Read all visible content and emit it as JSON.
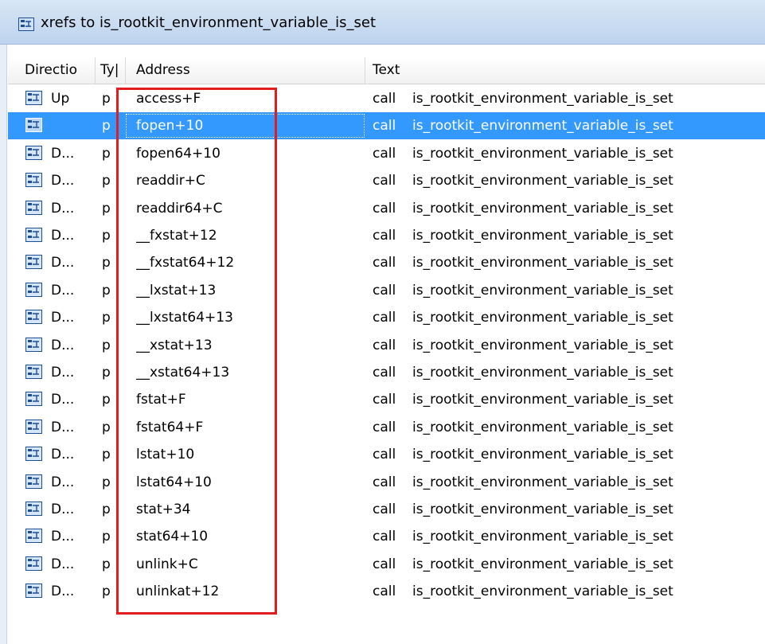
{
  "window": {
    "title": "xrefs to is_rootkit_environment_variable_is_set",
    "icon": "xref-window-icon"
  },
  "columns": {
    "direction": "Directio",
    "type": "Ty|",
    "address": "Address",
    "text": "Text"
  },
  "selected_row_index": 1,
  "highlight_color": "#e31d1d",
  "selection_color": "#3399ff",
  "rows": [
    {
      "direction": "Up",
      "type": "p",
      "address": "access+F",
      "instr": "call",
      "target": "is_rootkit_environment_variable_is_set"
    },
    {
      "direction": "",
      "type": "p",
      "address": "fopen+10",
      "instr": "call",
      "target": "is_rootkit_environment_variable_is_set"
    },
    {
      "direction": "D...",
      "type": "p",
      "address": "fopen64+10",
      "instr": "call",
      "target": "is_rootkit_environment_variable_is_set"
    },
    {
      "direction": "D...",
      "type": "p",
      "address": "readdir+C",
      "instr": "call",
      "target": "is_rootkit_environment_variable_is_set"
    },
    {
      "direction": "D...",
      "type": "p",
      "address": "readdir64+C",
      "instr": "call",
      "target": "is_rootkit_environment_variable_is_set"
    },
    {
      "direction": "D...",
      "type": "p",
      "address": "__fxstat+12",
      "instr": "call",
      "target": "is_rootkit_environment_variable_is_set"
    },
    {
      "direction": "D...",
      "type": "p",
      "address": "__fxstat64+12",
      "instr": "call",
      "target": "is_rootkit_environment_variable_is_set"
    },
    {
      "direction": "D...",
      "type": "p",
      "address": "__lxstat+13",
      "instr": "call",
      "target": "is_rootkit_environment_variable_is_set"
    },
    {
      "direction": "D...",
      "type": "p",
      "address": "__lxstat64+13",
      "instr": "call",
      "target": "is_rootkit_environment_variable_is_set"
    },
    {
      "direction": "D...",
      "type": "p",
      "address": "__xstat+13",
      "instr": "call",
      "target": "is_rootkit_environment_variable_is_set"
    },
    {
      "direction": "D...",
      "type": "p",
      "address": "__xstat64+13",
      "instr": "call",
      "target": "is_rootkit_environment_variable_is_set"
    },
    {
      "direction": "D...",
      "type": "p",
      "address": "fstat+F",
      "instr": "call",
      "target": "is_rootkit_environment_variable_is_set"
    },
    {
      "direction": "D...",
      "type": "p",
      "address": "fstat64+F",
      "instr": "call",
      "target": "is_rootkit_environment_variable_is_set"
    },
    {
      "direction": "D...",
      "type": "p",
      "address": "lstat+10",
      "instr": "call",
      "target": "is_rootkit_environment_variable_is_set"
    },
    {
      "direction": "D...",
      "type": "p",
      "address": "lstat64+10",
      "instr": "call",
      "target": "is_rootkit_environment_variable_is_set"
    },
    {
      "direction": "D...",
      "type": "p",
      "address": "stat+34",
      "instr": "call",
      "target": "is_rootkit_environment_variable_is_set"
    },
    {
      "direction": "D...",
      "type": "p",
      "address": "stat64+10",
      "instr": "call",
      "target": "is_rootkit_environment_variable_is_set"
    },
    {
      "direction": "D...",
      "type": "p",
      "address": "unlink+C",
      "instr": "call",
      "target": "is_rootkit_environment_variable_is_set"
    },
    {
      "direction": "D...",
      "type": "p",
      "address": "unlinkat+12",
      "instr": "call",
      "target": "is_rootkit_environment_variable_is_set"
    }
  ]
}
